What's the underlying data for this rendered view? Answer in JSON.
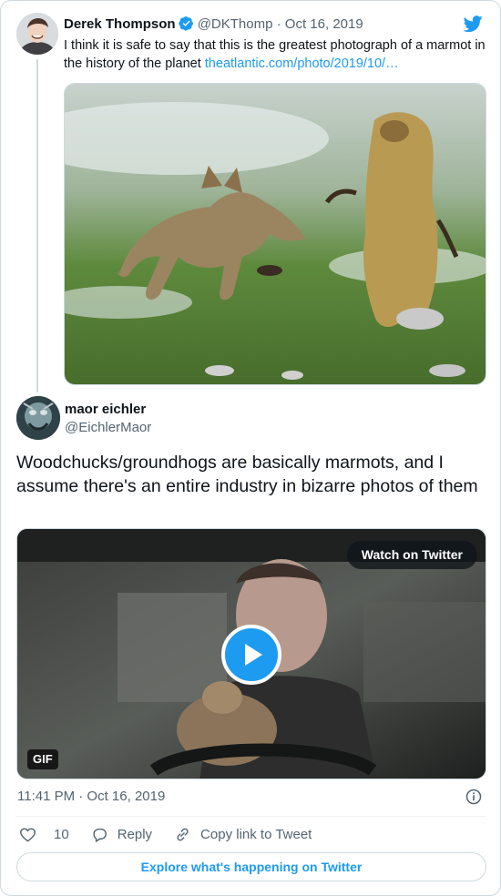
{
  "parent_tweet": {
    "name": "Derek Thompson",
    "handle": "@DKThomp",
    "separator": "·",
    "date": "Oct 16, 2019",
    "text": "I think it is safe to say that this is the greatest photograph of a marmot in the history of the planet",
    "link_text": "theatlantic.com/photo/2019/10/…"
  },
  "tweet": {
    "name": "maor eichler",
    "handle": "@EichlerMaor",
    "text": "Woodchucks/groundhogs are basically marmots, and I assume there's an entire industry in bizarre photos of them",
    "media": {
      "watch_label": "Watch on Twitter",
      "gif_label": "GIF"
    },
    "timestamp": "11:41 PM · Oct 16, 2019"
  },
  "actions": {
    "like_count": "10",
    "reply_label": "Reply",
    "copy_link_label": "Copy link to Tweet"
  },
  "footer": {
    "explore_label": "Explore what's happening on Twitter"
  },
  "colors": {
    "accent": "#1d9bf0",
    "muted_text": "#536471",
    "border": "#cfd9de"
  },
  "icons": [
    "twitter-bird-icon",
    "verified-badge-icon",
    "play-icon",
    "info-icon",
    "heart-icon",
    "reply-icon",
    "link-icon"
  ]
}
